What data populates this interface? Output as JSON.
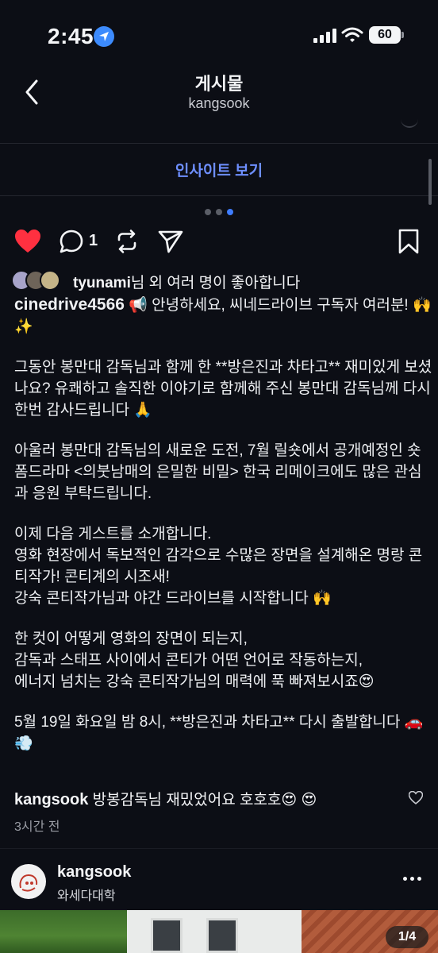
{
  "status_bar": {
    "time": "2:45",
    "battery": "60",
    "icons": [
      "location-arrow-icon",
      "signal-icon",
      "wifi-icon",
      "battery-icon"
    ]
  },
  "header": {
    "title": "게시물",
    "username": "kangsook"
  },
  "insights_label": "인사이트 보기",
  "carousel": {
    "dots": 3,
    "active_index": 2
  },
  "actions": {
    "liked": true,
    "comment_count": "1",
    "like_color": "#ff3040"
  },
  "likes": {
    "username": "tyunami",
    "suffix": "님 외 여러 명이 좋아합니다"
  },
  "caption": {
    "author": "cinedrive4566",
    "line1": " 📢 안녕하세요, 씨네드라이브 구독자 여러분! 🙌 ✨",
    "para1": "그동안 봉만대 감독님과 함께 한 **방은진과 차타고** 재미있게 보셨나요? 유쾌하고 솔직한 이야기로 함께해 주신 봉만대 감독님께 다시 한번 감사드립니다 🙏",
    "para2": "아울러 봉만대 감독님의 새로운 도전, 7월 릴숏에서 공개예정인 숏폼드라마 <의붓남매의 은밀한 비밀> 한국 리메이크에도 많은 관심과 응원 부탁드립니다.",
    "para3": "이제 다음 게스트를 소개합니다.\n영화 현장에서 독보적인 감각으로 수많은 장면을 설계해온 명랑 콘티작가! 콘티계의 시조새!\n강숙 콘티작가님과 야간 드라이브를 시작합니다 🙌",
    "para4": "한 컷이 어떻게 영화의 장면이 되는지,\n감독과 스태프 사이에서 콘티가 어떤 언어로 작동하는지,\n에너지 넘치는 강숙 콘티작가님의 매력에 푹 빠져보시죠😍",
    "para5": "5월 19일 화요일 밤 8시, **방은진과 차타고** 다시 출발합니다 🚗💨"
  },
  "comment": {
    "author": "kangsook",
    "text": " 방봉감독님 재밌었어요 호호호😍 😍"
  },
  "timestamp": "3시간 전",
  "next_post": {
    "username": "kangsook",
    "location": "와세다대학",
    "image_counter": "1/4"
  }
}
